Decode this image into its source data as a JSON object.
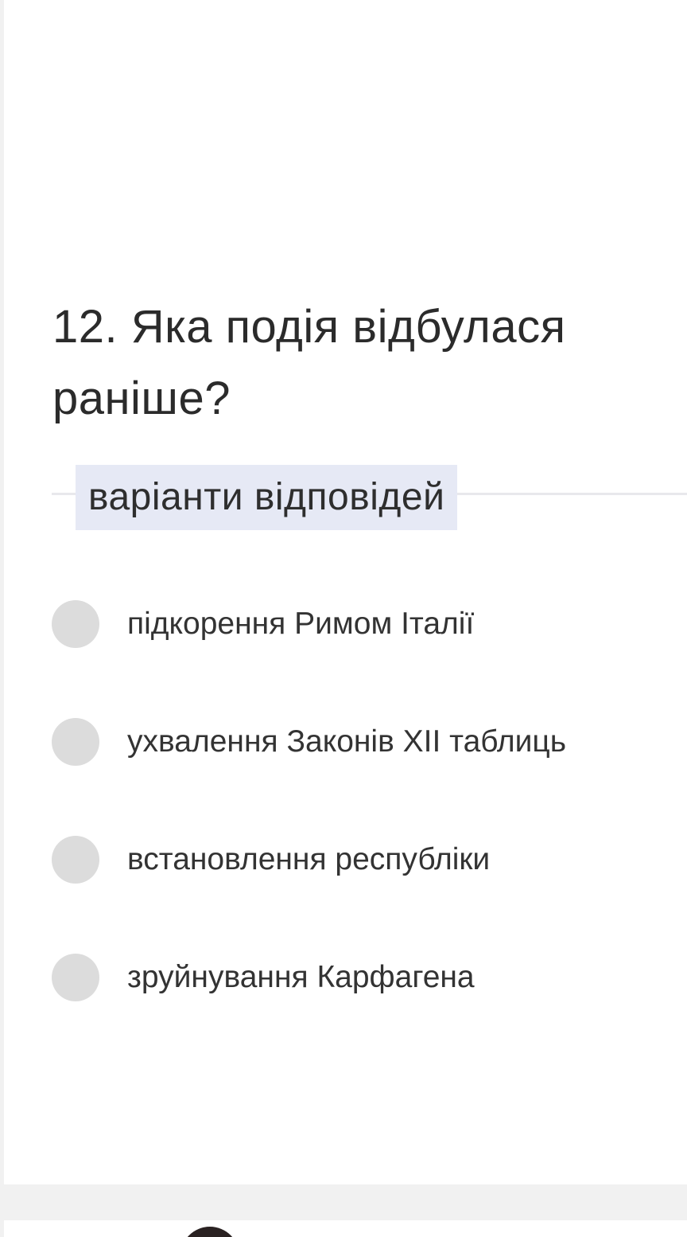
{
  "question": {
    "text": "12. Яка подія відбулася раніше?"
  },
  "answers_section": {
    "label": "варіанти відповідей"
  },
  "options": [
    {
      "label": "підкорення Римом Італії",
      "selected": false
    },
    {
      "label": "ухвалення Законів XII таблиць",
      "selected": false
    },
    {
      "label": "встановлення республіки",
      "selected": false
    },
    {
      "label": "зруйнування Карфагена",
      "selected": false
    }
  ],
  "colors": {
    "page_background": "#f1f1f1",
    "card_background": "#ffffff",
    "radio_fill": "#dcdcdc",
    "section_label_background": "#e6e9f5",
    "text": "#333333"
  }
}
